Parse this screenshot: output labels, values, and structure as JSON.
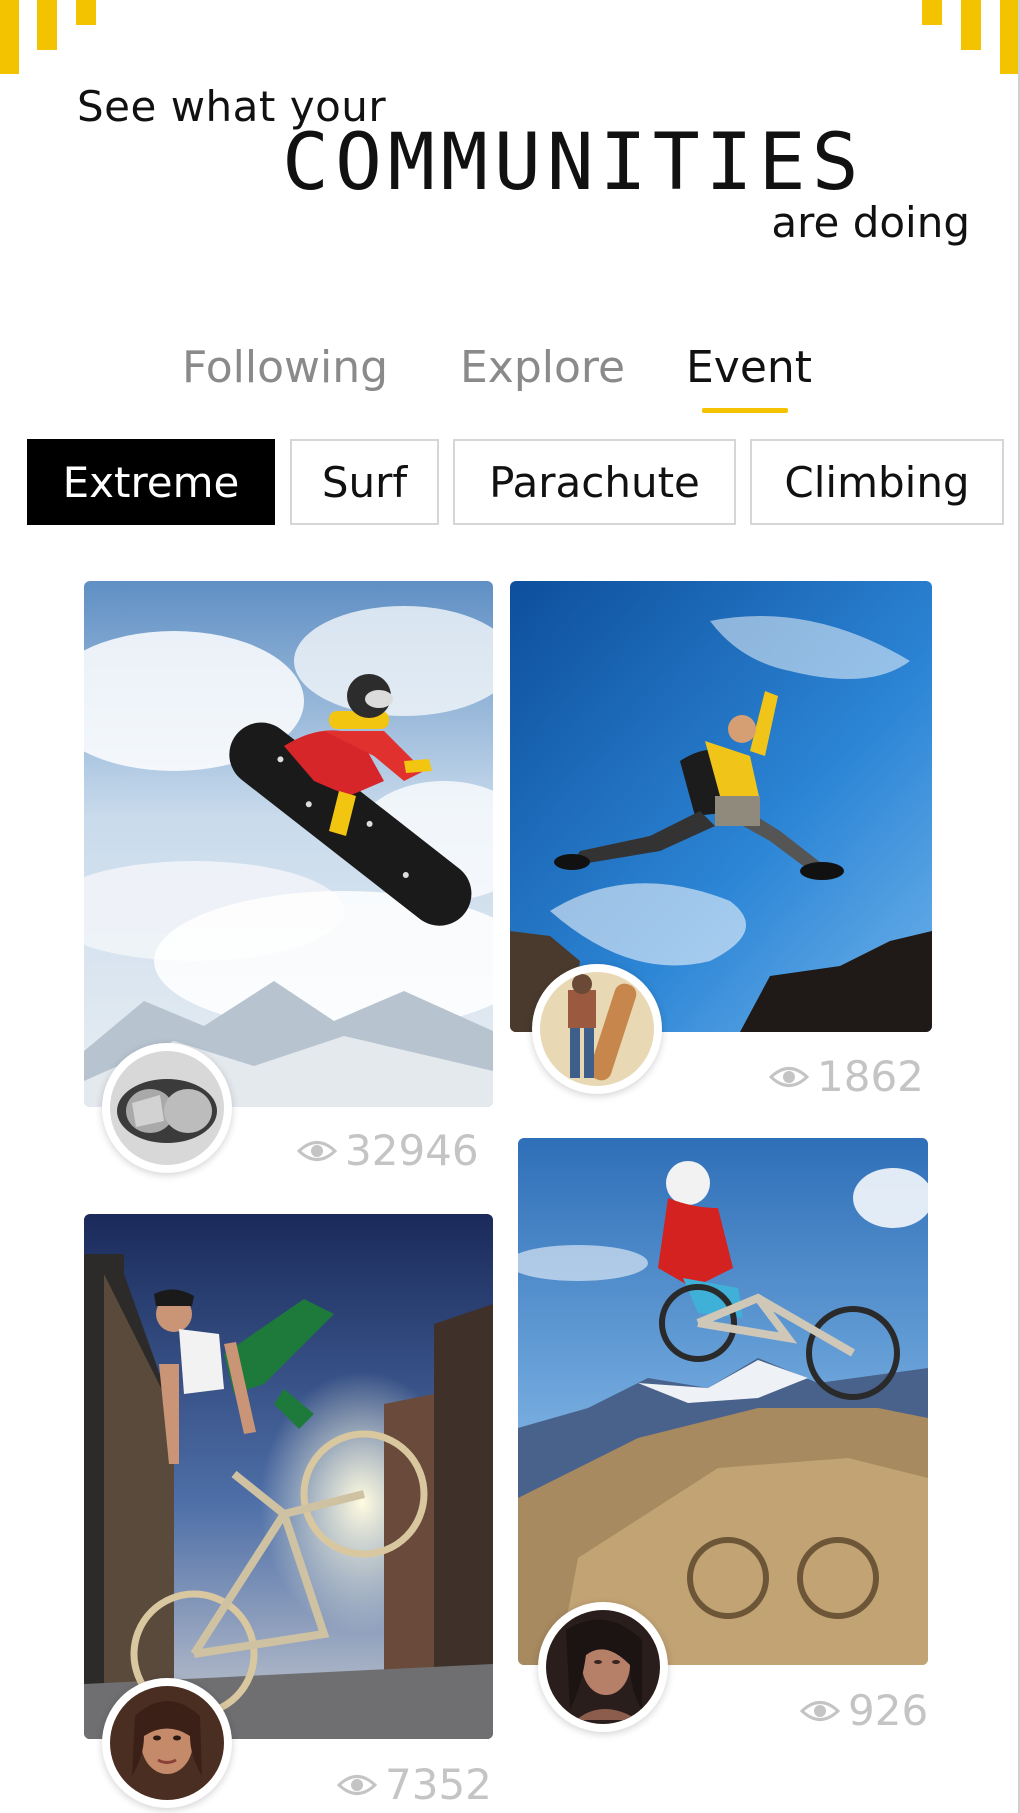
{
  "header": {
    "line1": "See what your",
    "line2": "COMMUNITIES",
    "line3": "are doing"
  },
  "tabs": [
    {
      "label": "Following",
      "active": false
    },
    {
      "label": "Explore",
      "active": false
    },
    {
      "label": "Event",
      "active": true
    }
  ],
  "categories": [
    {
      "label": "Extreme",
      "active": true
    },
    {
      "label": "Surf",
      "active": false
    },
    {
      "label": "Parachute",
      "active": false
    },
    {
      "label": "Climbing",
      "active": false
    }
  ],
  "cards": [
    {
      "photo": "snowboarder-jump-photo",
      "avatar": "goggles-avatar",
      "views": "32946"
    },
    {
      "photo": "hiker-leap-photo",
      "avatar": "skateboarder-avatar",
      "views": "1862"
    },
    {
      "photo": "bmx-rider-photo",
      "avatar": "woman-portrait-avatar",
      "views": "7352"
    },
    {
      "photo": "mountain-bike-jump-photo",
      "avatar": "woman-portrait-avatar",
      "views": "926"
    }
  ],
  "colors": {
    "accent": "#f4c300",
    "active_chip_bg": "#000000",
    "inactive_tab": "#8a8a8a",
    "views_text": "#c4c4c4"
  },
  "icons": {
    "views": "eye-icon"
  }
}
